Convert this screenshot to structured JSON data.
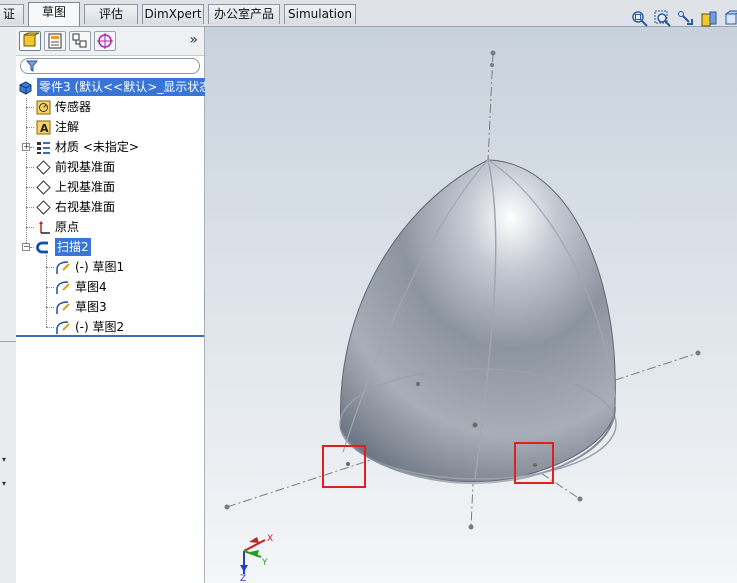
{
  "tabs": [
    {
      "label": "证",
      "active": false
    },
    {
      "label": "草图",
      "active": true
    },
    {
      "label": "评估",
      "active": false
    },
    {
      "label": "DimXpert",
      "active": false
    },
    {
      "label": "办公室产品",
      "active": false
    },
    {
      "label": "Simulation",
      "active": false
    }
  ],
  "feature_manager": {
    "expand_label": "»",
    "root": "零件3 (默认<<默认>_显示状态",
    "items": [
      {
        "label": "传感器"
      },
      {
        "label": "注解"
      },
      {
        "label": "材质 <未指定>"
      },
      {
        "label": "前视基准面"
      },
      {
        "label": "上视基准面"
      },
      {
        "label": "右视基准面"
      },
      {
        "label": "原点"
      },
      {
        "label": "扫描2"
      }
    ],
    "children": [
      {
        "label": "(-) 草图1"
      },
      {
        "label": "草图4"
      },
      {
        "label": "草图3"
      },
      {
        "label": "(-) 草图2"
      }
    ]
  },
  "triad": {
    "x": "X",
    "y": "Y",
    "z": "Z"
  },
  "colors": {
    "selection": "#3875d7",
    "highlight_box": "#e02020",
    "viewport_top": "#c8d2dc",
    "viewport_bottom": "#f4f6f8"
  }
}
